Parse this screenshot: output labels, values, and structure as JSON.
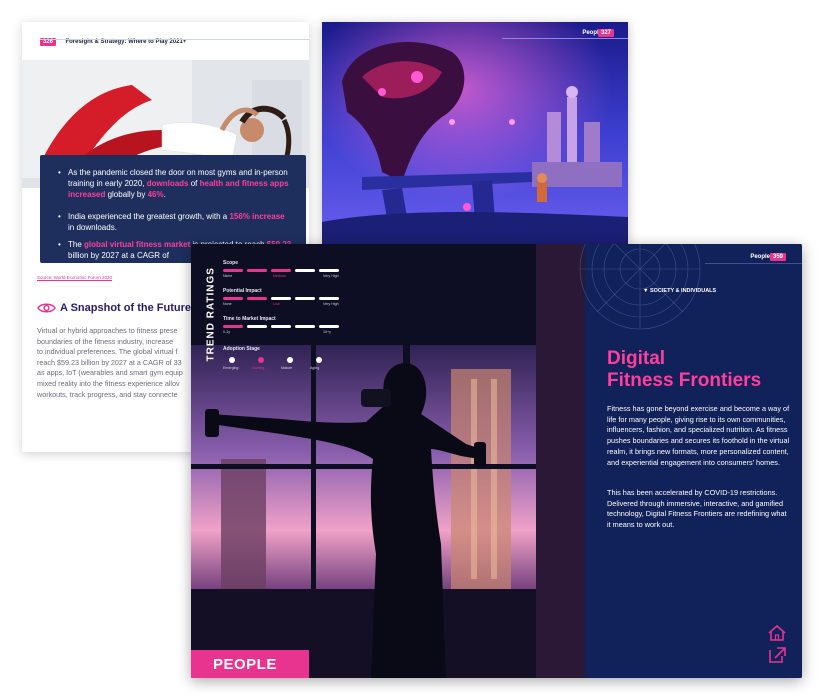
{
  "left_page": {
    "page_number": "326",
    "header": "Foresight & Strategy: Where to Play 2021+",
    "info_box": {
      "bullets": [
        {
          "parts": [
            {
              "text": "As the pandemic closed the door on most gyms and in-person training in early 2020, ",
              "highlight": false
            },
            {
              "text": "downloads",
              "highlight": true
            },
            {
              "text": " of ",
              "highlight": false
            },
            {
              "text": "health and fitness apps increased",
              "highlight": true
            },
            {
              "text": " globally by ",
              "highlight": false
            },
            {
              "text": "46%",
              "highlight": true
            },
            {
              "text": ".",
              "highlight": false
            }
          ]
        },
        {
          "parts": [
            {
              "text": "India experienced the greatest growth, with a ",
              "highlight": false
            },
            {
              "text": "156% increase",
              "highlight": true
            },
            {
              "text": " in downloads.",
              "highlight": false
            }
          ]
        },
        {
          "parts": [
            {
              "text": "The ",
              "highlight": false
            },
            {
              "text": "global virtual fitness market",
              "highlight": true
            },
            {
              "text": " is projected to reach ",
              "highlight": false
            },
            {
              "text": "$59.23",
              "highlight": true
            },
            {
              "text": " billion by 2027 at a CAGR of",
              "highlight": false
            }
          ]
        }
      ]
    },
    "source": "Source: World Economic Forum 2020",
    "section_title": "A Snapshot of the Future",
    "body_lines": [
      "Virtual or hybrid approaches to fitness prese",
      "boundaries of the fitness industry, increase",
      "to individual preferences. The global virtual f",
      "reach $59.23 billion by 2027 at a CAGR of 33",
      "as apps, IoT (wearables and smart gym equip",
      "mixed reality into the fitness experience allov",
      "workouts, track progress, and stay connecte"
    ]
  },
  "right_back_page": {
    "label": "People",
    "page_number": "327"
  },
  "front_spread": {
    "ratings_title": "TREND RATINGS",
    "ratings": [
      {
        "label": "Scope",
        "left": "Niche",
        "middle": "Medium",
        "right": "Very High",
        "level": 3,
        "segments": 5
      },
      {
        "label": "Potential Impact",
        "left": "None",
        "middle": "Low",
        "right": "Very High",
        "level": 2,
        "segments": 5
      },
      {
        "label": "Time to Market Impact",
        "left": "0-1y",
        "middle": "",
        "right": "10+y",
        "level": 1,
        "segments": 5
      }
    ],
    "adoption": {
      "label": "Adoption Stage",
      "stages": [
        "Emerging",
        "Gaining",
        "Mature",
        "Aging"
      ],
      "active_index": 1
    },
    "corner_tag": "PEOPLE",
    "page_label": "People",
    "page_number": "359",
    "category": "SOCIETY & INDIVIDUALS",
    "title_line1": "Digital",
    "title_line2": "Fitness Frontiers",
    "paragraph1": "Fitness has gone beyond exercise and become a way of life for many people, giving rise to its own communities, influencers, fashion, and specialized nutrition. As fitness pushes boundaries and secures its foothold in the virtual realm, it brings new formats, more personalized content, and experiential engagement into consumers' homes.",
    "paragraph2": "This has been accelerated by COVID-19 restrictions. Delivered through immersive, interactive, and gamified technology, Digital Fitness Frontiers are redefining what it means to work out.",
    "icons": [
      "home-icon",
      "external-link-icon"
    ]
  },
  "colors": {
    "accent_pink": "#e8348f",
    "navy": "#112159",
    "box_navy": "#1e2f5e",
    "heading_purple": "#2a1a6e"
  }
}
